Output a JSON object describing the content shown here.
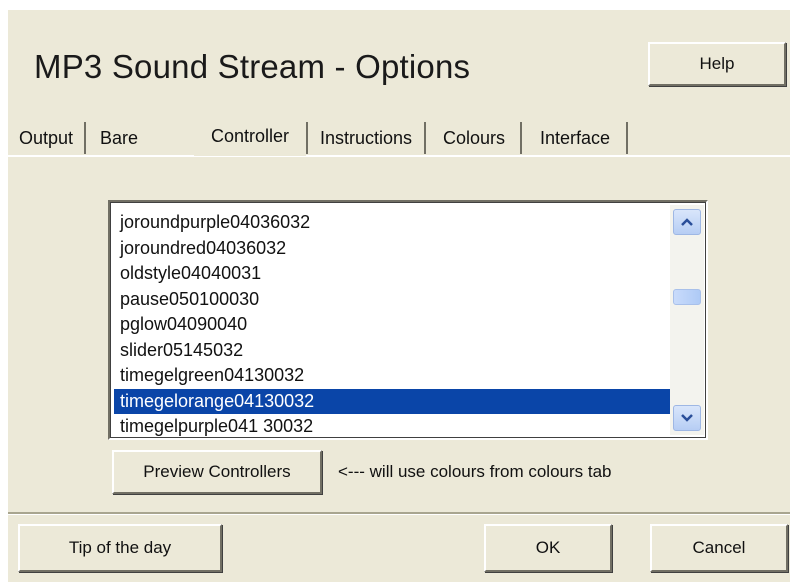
{
  "window": {
    "title": "MP3 Sound Stream - Options"
  },
  "header": {
    "help_label": "Help"
  },
  "tabs": [
    {
      "label": "Output"
    },
    {
      "label": "Bare"
    },
    {
      "label": "Controller",
      "active": true
    },
    {
      "label": "Instructions"
    },
    {
      "label": "Colours"
    },
    {
      "label": "Interface"
    }
  ],
  "controller": {
    "list": {
      "items": [
        "joroundpurple04036032",
        "joroundred04036032",
        "oldstyle04040031",
        "pause050100030",
        "pglow04090040",
        "slider05145032",
        "timegelgreen04130032",
        "timegelorange04130032",
        "timegelpurple041 30032"
      ],
      "selected": "timegelorange04130032"
    },
    "preview_label": "Preview Controllers",
    "hint": "<--- will use colours from colours tab"
  },
  "footer": {
    "tip_label": "Tip of the day",
    "ok_label": "OK",
    "cancel_label": "Cancel"
  },
  "colors": {
    "dialog_bg": "#ece9d8",
    "selection": "#0a45a8",
    "list_bg": "#ffffff"
  }
}
